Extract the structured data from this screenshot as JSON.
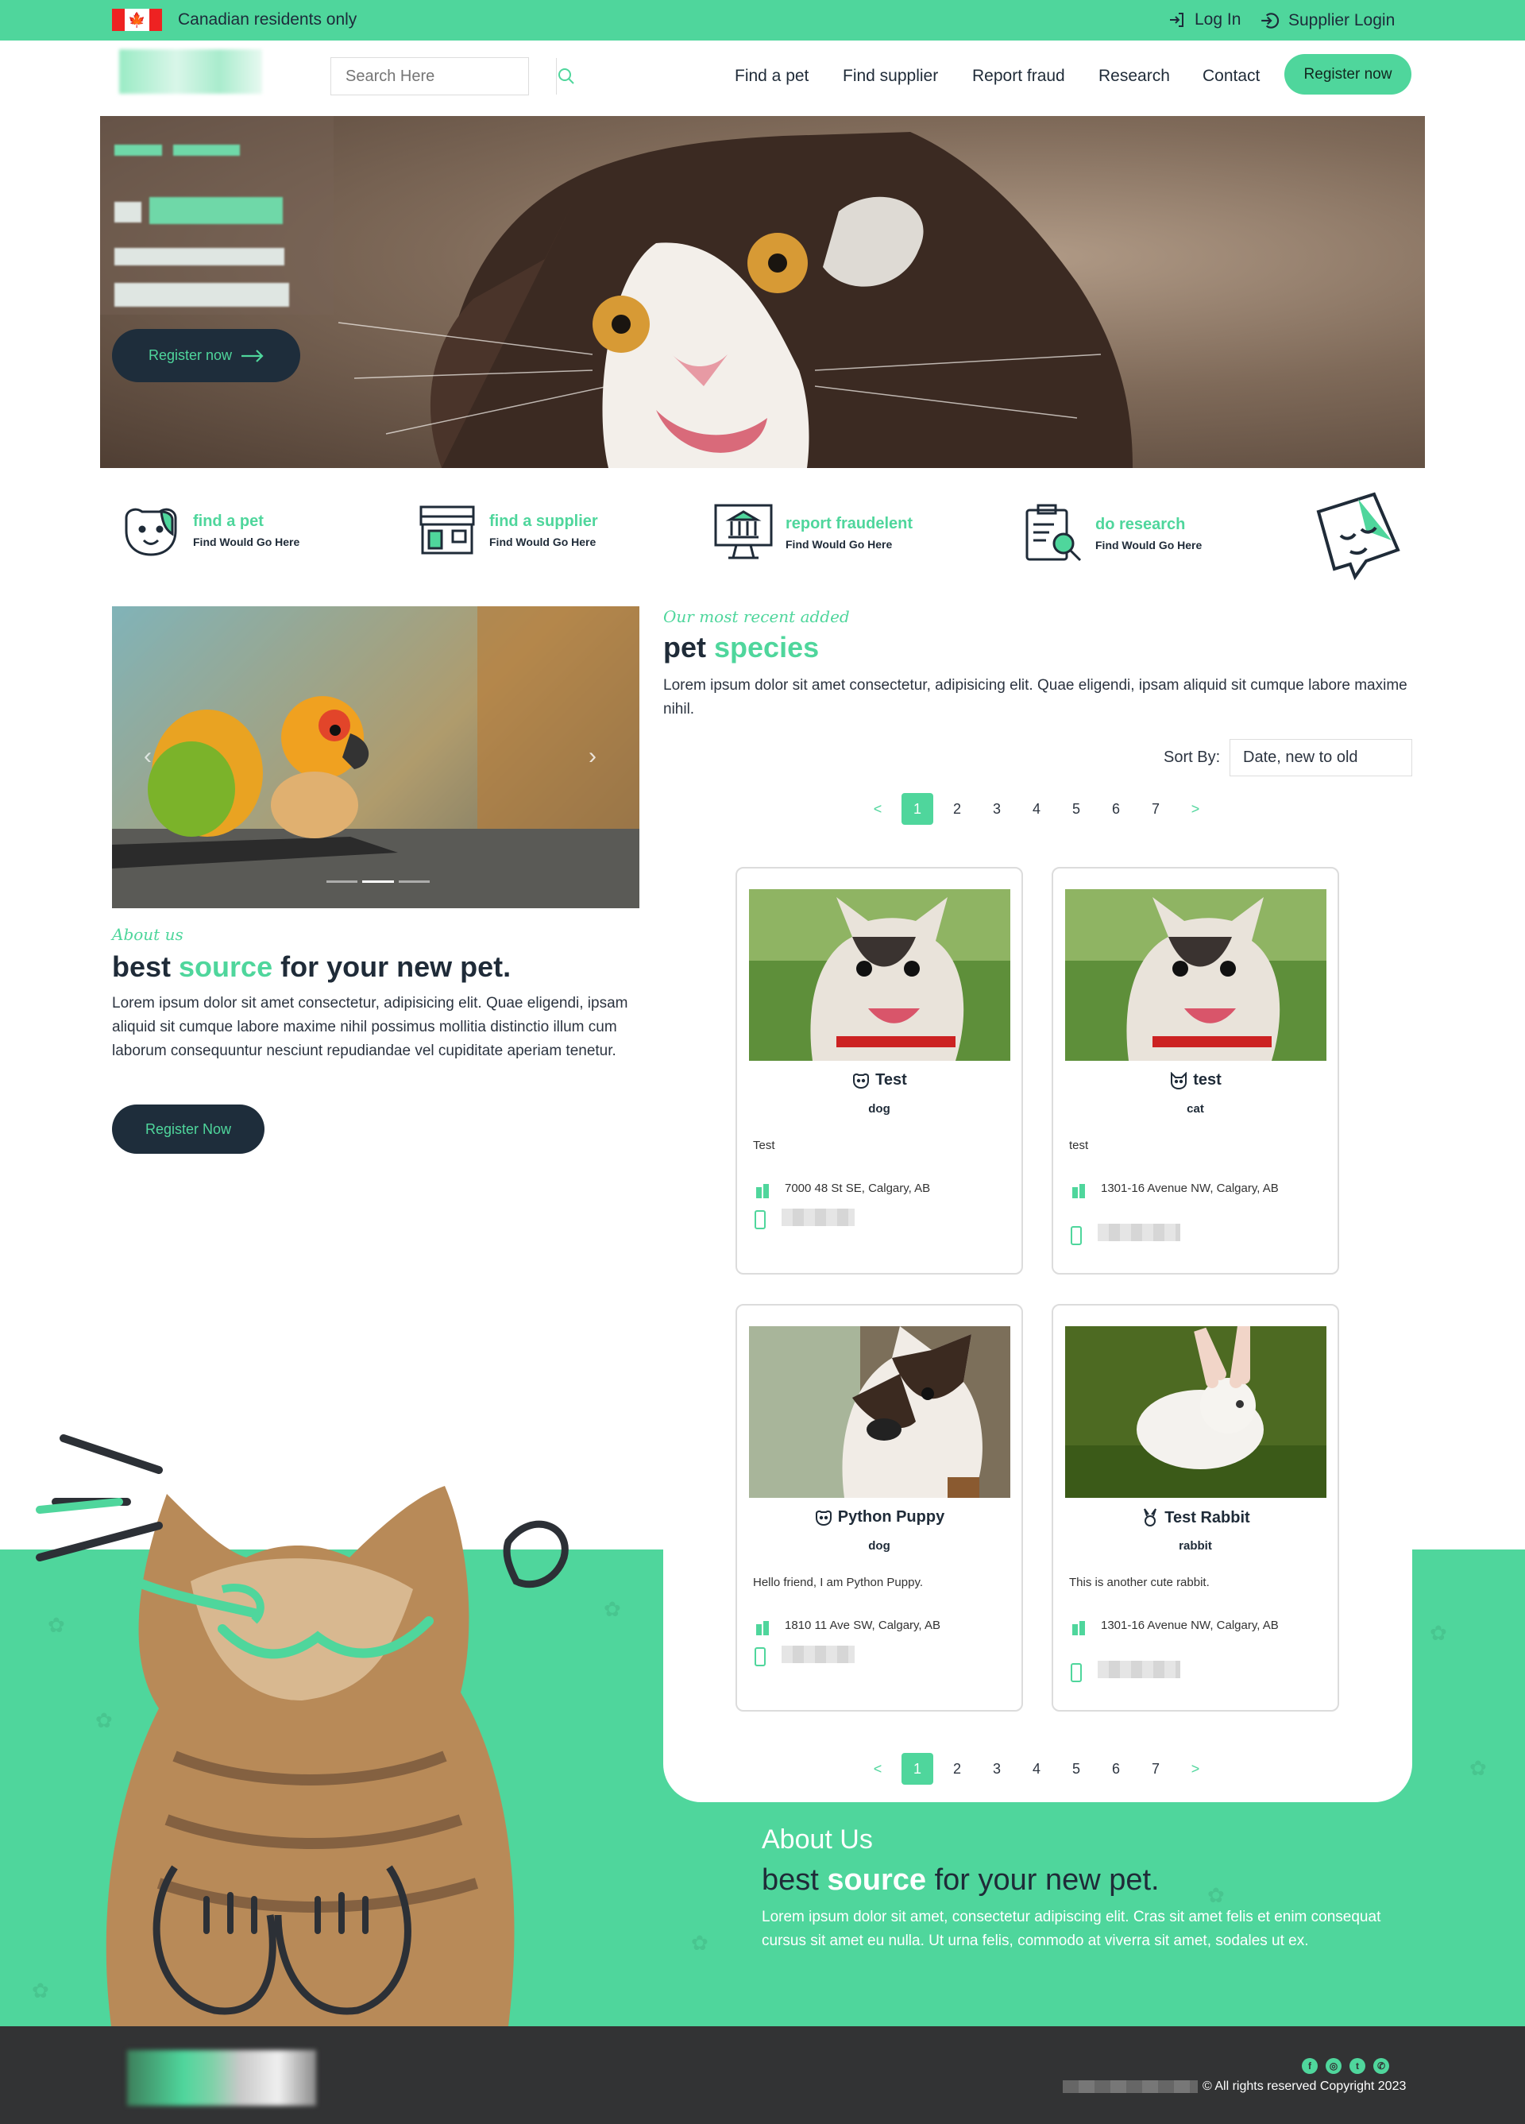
{
  "topbar": {
    "residents": "Canadian residents only",
    "login": "Log In",
    "supplier_login": "Supplier Login",
    "flag_icon": "canada-flag-icon"
  },
  "header": {
    "search_placeholder": "Search Here",
    "nav": [
      "Find a pet",
      "Find supplier",
      "Report fraud",
      "Research",
      "Contact"
    ],
    "register": "Register now"
  },
  "hero": {
    "register": "Register now"
  },
  "features": [
    {
      "title": "find a pet",
      "sub": "Find Would Go Here",
      "icon": "dog-face-icon"
    },
    {
      "title": "find a supplier",
      "sub": "Find Would Go Here",
      "icon": "storefront-icon"
    },
    {
      "title": "report fraudelent",
      "sub": "Find Would Go Here",
      "icon": "monitor-bank-icon"
    },
    {
      "title": "do research",
      "sub": "Find Would Go Here",
      "icon": "clipboard-search-icon"
    }
  ],
  "about": {
    "kicker": "About us",
    "title_a": "best ",
    "title_b": "source",
    "title_c": " for your new pet.",
    "body": "Lorem ipsum dolor sit amet consectetur, adipisicing elit. Quae eligendi, ipsam aliquid sit cumque labore maxime nihil possimus mollitia distinctio illum cum laborum consequuntur nesciunt repudiandae vel cupiditate aperiam tenetur.",
    "button": "Register Now"
  },
  "species": {
    "kicker": "Our most recent added",
    "title_a": "pet ",
    "title_b": "species",
    "body": "Lorem ipsum dolor sit amet consectetur, adipisicing elit. Quae eligendi, ipsam aliquid sit cumque labore maxime nihil.",
    "sort_label": "Sort By:",
    "sort_value": "Date, new to old"
  },
  "pagination": {
    "pages": [
      "1",
      "2",
      "3",
      "4",
      "5",
      "6",
      "7"
    ],
    "current": "1",
    "prev": "<",
    "next": ">"
  },
  "cards": [
    {
      "name": "Test",
      "species": "dog",
      "desc": "Test",
      "addr": "7000 48 St SE, Calgary, AB",
      "icon": "dog-face-icon"
    },
    {
      "name": "test",
      "species": "cat",
      "desc": "test",
      "addr": "1301-16 Avenue NW, Calgary, AB",
      "icon": "cat-face-icon"
    },
    {
      "name": "Python Puppy",
      "species": "dog",
      "desc": "Hello friend, I am Python Puppy.",
      "addr": "1810 11 Ave SW, Calgary, AB",
      "icon": "dog-face-icon"
    },
    {
      "name": "Test Rabbit",
      "species": "rabbit",
      "desc": "This is another cute rabbit.",
      "addr": "1301-16 Avenue NW, Calgary, AB",
      "icon": "rabbit-face-icon"
    }
  ],
  "about2": {
    "kicker": "About Us",
    "title_a": "best ",
    "title_b": "source",
    "title_c": " for your new pet.",
    "body": "Lorem ipsum dolor sit amet, consectetur adipiscing elit. Cras sit amet felis et enim consequat cursus sit amet eu nulla. Ut urna felis, commodo at viverra sit amet, sodales ut ex."
  },
  "footer": {
    "copyright": "© All rights reserved Copyright 2023",
    "social": [
      "facebook-icon",
      "instagram-icon",
      "twitter-icon",
      "whatsapp-icon"
    ]
  },
  "colors": {
    "accent": "#4fd69c",
    "dark": "#1e2d3b",
    "footer": "#323334"
  }
}
